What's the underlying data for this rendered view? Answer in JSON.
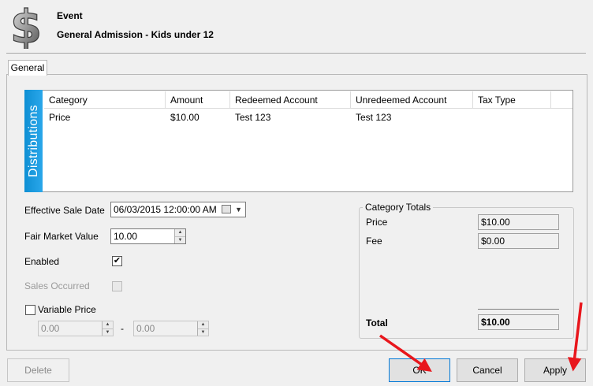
{
  "header": {
    "logo_glyph": "$",
    "title": "Event",
    "subtitle": "General Admission - Kids under 12"
  },
  "tabs": [
    {
      "label": "General",
      "active": true
    }
  ],
  "distributions": {
    "side_label": "Distributions",
    "columns": [
      "Category",
      "Amount",
      "Redeemed Account",
      "Unredeemed Account",
      "Tax Type"
    ],
    "rows": [
      {
        "category": "Price",
        "amount": "$10.00",
        "redeemed": "Test 123",
        "unredeemed": "Test 123",
        "tax_type": ""
      }
    ]
  },
  "form": {
    "effective_sale_date_label": "Effective Sale Date",
    "effective_sale_date_value": "06/03/2015 12:00:00 AM",
    "fair_market_value_label": "Fair Market Value",
    "fair_market_value": "10.00",
    "enabled_label": "Enabled",
    "enabled_checked": "✔",
    "sales_occurred_label": "Sales Occurred",
    "variable_price_label": "Variable Price",
    "variable_min": "0.00",
    "variable_max": "0.00",
    "range_separator": "-"
  },
  "category_totals": {
    "title": "Category Totals",
    "price_label": "Price",
    "price_value": "$10.00",
    "fee_label": "Fee",
    "fee_value": "$0.00",
    "total_label": "Total",
    "total_value": "$10.00"
  },
  "buttons": {
    "delete": "Delete",
    "ok": "OK",
    "cancel": "Cancel",
    "apply": "Apply"
  },
  "annotation_color": "#e8161c"
}
